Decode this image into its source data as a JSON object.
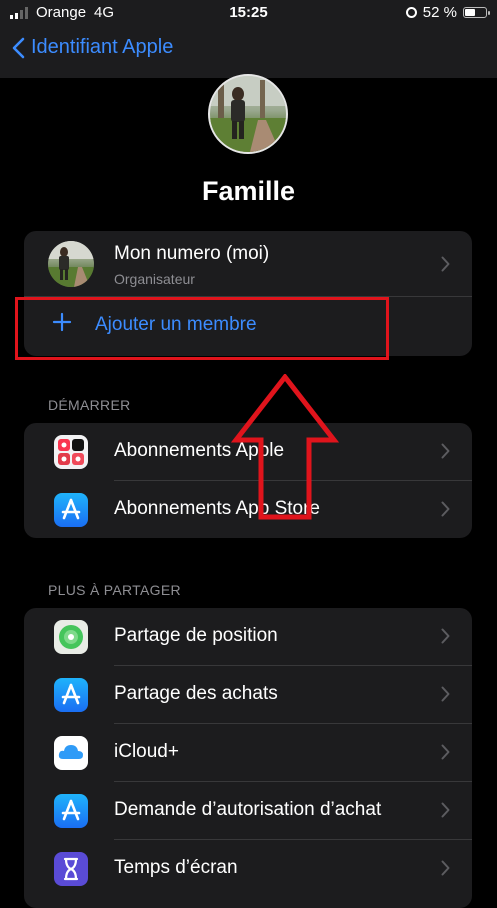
{
  "status_bar": {
    "carrier": "Orange",
    "network": "4G",
    "time": "15:25",
    "battery": "52 %",
    "battery_level": 0.52
  },
  "nav": {
    "back_label": "Identifiant Apple"
  },
  "title": "Famille",
  "family": {
    "member": {
      "name": "Mon numero (moi)",
      "role": "Organisateur"
    },
    "add_label": "Ajouter un membre"
  },
  "sections": {
    "start": {
      "header": "DÉMARRER",
      "items": [
        {
          "label": "Abonnements Apple",
          "icon": "apple-subscriptions-icon"
        },
        {
          "label": "Abonnements App Store",
          "icon": "app-store-icon"
        }
      ]
    },
    "share": {
      "header": "PLUS À PARTAGER",
      "items": [
        {
          "label": "Partage de position",
          "icon": "find-my-icon"
        },
        {
          "label": "Partage des achats",
          "icon": "app-store-icon"
        },
        {
          "label": "iCloud+",
          "icon": "icloud-icon"
        },
        {
          "label": "Demande d’autorisation d’achat",
          "icon": "app-store-icon"
        },
        {
          "label": "Temps d’écran",
          "icon": "screen-time-icon"
        }
      ]
    }
  },
  "colors": {
    "accent": "#3c8cff",
    "annotation": "#e0141c",
    "cell": "#1c1c1e"
  }
}
